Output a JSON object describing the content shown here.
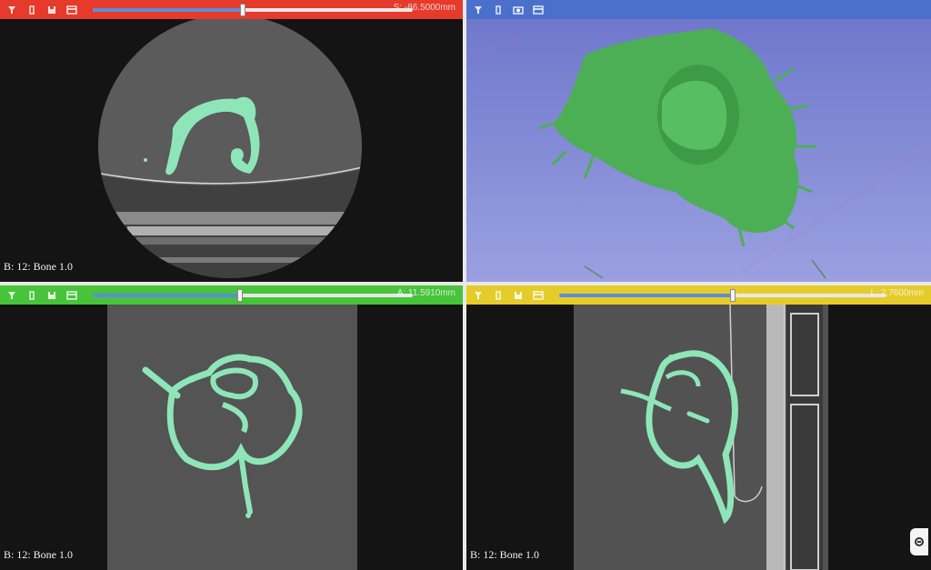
{
  "panels": {
    "red": {
      "color": "#e53a2c",
      "slider_value": 0.47,
      "readout": "S: -86.5000mm",
      "label": "B: 12: Bone 1.0"
    },
    "blue": {
      "color": "#4b70cc"
    },
    "green": {
      "color": "#47c43a",
      "slider_value": 0.46,
      "readout": "A: 11.5910mm",
      "label": "B: 12: Bone 1.0"
    },
    "yellow": {
      "color": "#e6cc2a",
      "slider_value": 0.53,
      "readout": "L: 2.7600mm",
      "label": "B: 12: Bone 1.0"
    }
  },
  "icons": {
    "toolbar": [
      "pin-icon",
      "link-icon",
      "save-icon",
      "layout-icon"
    ],
    "blue_toolbar": [
      "pin-icon",
      "link-icon",
      "camera-icon",
      "layout-icon"
    ],
    "corner": "collapse-icon"
  },
  "colors": {
    "segmentation": "#8ee6b8",
    "render_green": "#4caf55",
    "render_background": "#7e86d4"
  }
}
